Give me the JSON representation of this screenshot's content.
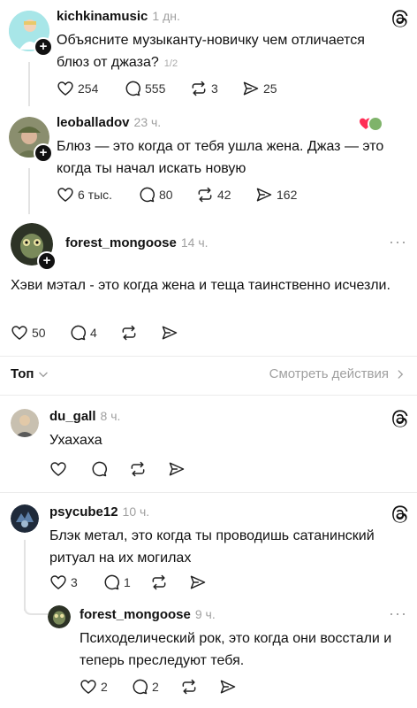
{
  "posts": [
    {
      "username": "kichkinamusic",
      "time": "1 дн.",
      "text": "Объясните музыканту-новичку чем отличается блюз от джаза?",
      "part_badge": "1/2",
      "likes": "254",
      "comments": "555",
      "reposts": "3",
      "shares": "25"
    },
    {
      "username": "leoballadov",
      "time": "23 ч.",
      "text": "Блюз — это когда от тебя ушла жена. Джаз — это когда ты начал искать новую",
      "likes": "6 тыс.",
      "comments": "80",
      "reposts": "42",
      "shares": "162"
    },
    {
      "username": "forest_mongoose",
      "time": "14 ч.",
      "text": "Хэви мэтал - это когда жена и теща таинственно исчезли.",
      "likes": "50",
      "comments": "4"
    }
  ],
  "sort": {
    "label": "Топ",
    "view_activity": "Смотреть действия"
  },
  "replies": [
    {
      "username": "du_gall",
      "time": "8 ч.",
      "text": "Ухахаха"
    },
    {
      "username": "psycube12",
      "time": "10 ч.",
      "text": "Блэк метал, это когда ты проводишь сатанинский ритуал на их могилах",
      "likes": "3",
      "comments": "1"
    },
    {
      "username": "forest_mongoose",
      "time": "9 ч.",
      "text": "Психоделический рок, это когда они восстали и теперь преследуют тебя.",
      "likes": "2",
      "comments": "2"
    }
  ],
  "colors": {
    "text": "#111111",
    "muted": "#a0a0a0",
    "divider": "#ececec"
  }
}
